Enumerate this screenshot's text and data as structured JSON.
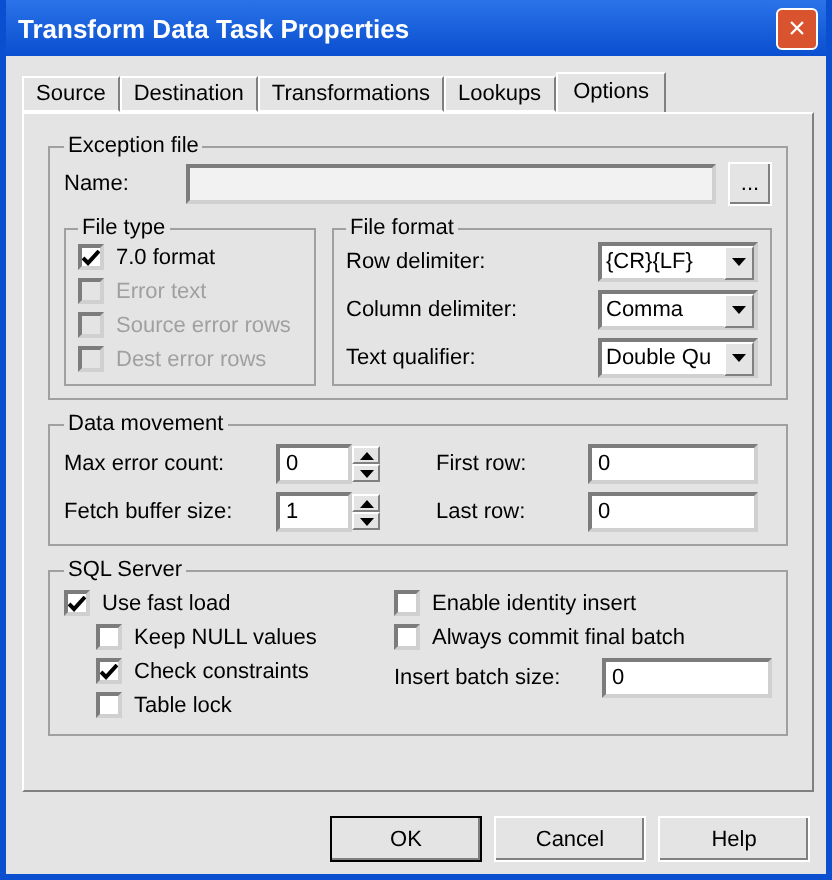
{
  "window": {
    "title": "Transform Data Task Properties",
    "close": "×"
  },
  "tabs": [
    {
      "label": "Source",
      "selected": false
    },
    {
      "label": "Destination",
      "selected": false
    },
    {
      "label": "Transformations",
      "selected": false
    },
    {
      "label": "Lookups",
      "selected": false
    },
    {
      "label": "Options",
      "selected": true
    }
  ],
  "exception_file": {
    "title": "Exception file",
    "name_label": "Name:",
    "browse_button": "...",
    "file_type": {
      "title": "File type",
      "options": [
        {
          "label": "7.0 format",
          "checked": true,
          "disabled": false
        },
        {
          "label": "Error text",
          "checked": false,
          "disabled": true
        },
        {
          "label": "Source error rows",
          "checked": false,
          "disabled": true
        },
        {
          "label": "Dest error rows",
          "checked": false,
          "disabled": true
        }
      ]
    },
    "file_format": {
      "title": "File format",
      "fields": [
        {
          "label": "Row delimiter:",
          "value": "{CR}{LF}"
        },
        {
          "label": "Column delimiter:",
          "value": "Comma"
        },
        {
          "label": "Text qualifier:",
          "value": "Double Qu"
        }
      ]
    }
  },
  "data_movement": {
    "title": "Data movement",
    "fields": [
      {
        "kind": "spinner",
        "label": "Max error count:",
        "value": "0"
      },
      {
        "kind": "text",
        "label": "First row:",
        "value": "0"
      },
      {
        "kind": "spinner",
        "label": "Fetch buffer size:",
        "value": "1"
      },
      {
        "kind": "text",
        "label": "Last row:",
        "value": "0"
      }
    ]
  },
  "sql_server": {
    "title": "SQL Server",
    "left": [
      {
        "label": "Use fast load",
        "checked": true,
        "children": [
          {
            "label": "Keep NULL values",
            "checked": false
          },
          {
            "label": "Check constraints",
            "checked": true
          },
          {
            "label": "Table lock",
            "checked": false
          }
        ]
      }
    ],
    "right": [
      {
        "label": "Enable identity insert",
        "checked": false
      },
      {
        "label": "Always commit final batch",
        "checked": false
      }
    ],
    "batch_field": {
      "label": "Insert batch size:",
      "value": "0"
    }
  },
  "buttons": [
    {
      "label": "OK",
      "default": true
    },
    {
      "label": "Cancel",
      "default": false
    },
    {
      "label": "Help",
      "default": false
    }
  ]
}
